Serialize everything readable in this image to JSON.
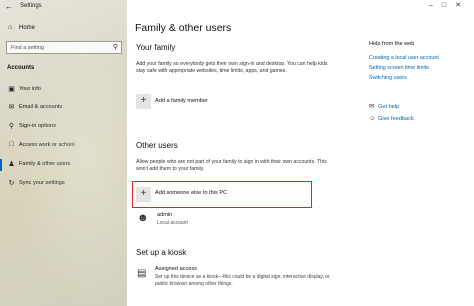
{
  "app": {
    "title": "Settings",
    "back_icon": "back-arrow-icon"
  },
  "sidebar": {
    "home_label": "Home",
    "search_placeholder": "Find a setting",
    "section_label": "Accounts",
    "items": [
      {
        "label": "Your info",
        "icon": "person-card-icon"
      },
      {
        "label": "Email & accounts",
        "icon": "mail-icon"
      },
      {
        "label": "Sign-in options",
        "icon": "key-icon"
      },
      {
        "label": "Access work or school",
        "icon": "briefcase-icon"
      },
      {
        "label": "Family & other users",
        "icon": "people-icon",
        "active": true
      },
      {
        "label": "Sync your settings",
        "icon": "sync-icon"
      }
    ]
  },
  "main": {
    "title": "Family & other users",
    "family": {
      "heading": "Your family",
      "description": "Add your family so everybody gets their own sign-in and desktop. You can help kids stay safe with appropriate websites, time limits, apps, and games.",
      "add_label": "Add a family member"
    },
    "other": {
      "heading": "Other users",
      "description": "Allow people who are not part of your family to sign in with their own accounts. This won't add them to your family.",
      "add_label": "Add someone else to this PC",
      "user": {
        "name": "admin",
        "type": "Local account"
      }
    },
    "kiosk": {
      "heading": "Set up a kiosk",
      "label": "Assigned access",
      "description": "Set up this device as a kiosk—this could be a digital sign, interactive display, or public browser among other things."
    }
  },
  "help": {
    "title": "Help from the web",
    "links": [
      "Creating a local user account",
      "Setting screen time limits",
      "Switching users"
    ],
    "get_help": "Get help",
    "feedback": "Give feedback"
  },
  "colors": {
    "accent": "#0067c0",
    "link": "#0066b4",
    "highlight": "#e0202a"
  }
}
